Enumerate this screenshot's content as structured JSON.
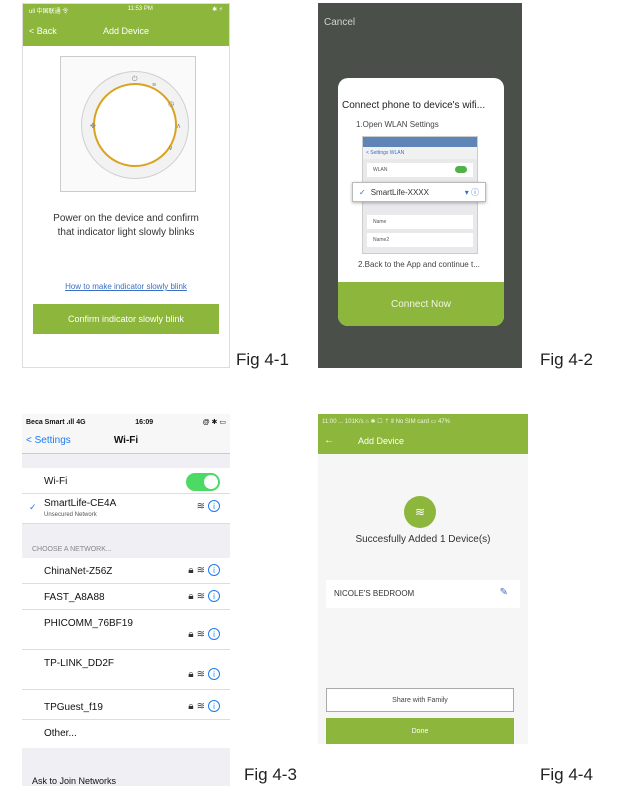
{
  "figures": {
    "fig1": "Fig 4-1",
    "fig2": "Fig 4-2",
    "fig3": "Fig 4-3",
    "fig4": "Fig 4-4"
  },
  "colors": {
    "accent_green": "#8db63c",
    "ios_blue": "#1a7cf5",
    "link_blue": "#3a6fc4",
    "dial_gold": "#d9a321"
  },
  "screen1": {
    "status_left": "ull 中国联通 令",
    "status_time": "11:53 PM",
    "status_right": "✱ ⚡",
    "back": "< Back",
    "title": "Add Device",
    "instruction_line1": "Power on the device and confirm",
    "instruction_line2": "that indicator light slowly blinks",
    "help_link": "How to make indicator slowly blink",
    "confirm_button": "Confirm indicator slowly blink",
    "dial_icons": [
      "power-icon",
      "menu-icon",
      "clock-icon",
      "up-icon",
      "down-icon",
      "fan-icon"
    ]
  },
  "screen2": {
    "cancel": "Cancel",
    "dialog_title": "Connect phone to device's wifi...",
    "step1": "1.Open WLAN Settings",
    "mini_nav": "< Settings   WLAN",
    "mini_wlan": "WLAN",
    "mini_other1": "Name",
    "mini_other2": "Name2",
    "selected_network": "SmartLife-XXXX",
    "step2": "2.Back to the App and continue t...",
    "connect_button": "Connect Now"
  },
  "screen3": {
    "status_left": "Beca Smart .ıll 4G",
    "status_time": "16:09",
    "status_right": "@ ✱ ▭",
    "back": "< Settings",
    "title": "Wi-Fi",
    "wifi_label": "Wi-Fi",
    "wifi_on": true,
    "connected": {
      "name": "SmartLife-CE4A",
      "sub": "Unsecured Network"
    },
    "section_header": "CHOOSE A NETWORK...",
    "networks": [
      "ChinaNet-Z56Z",
      "FAST_A8A88",
      "PHICOMM_76BF19",
      "TP-LINK_DD2F",
      "TPGuest_f19"
    ],
    "other": "Other...",
    "cutoff_text": "Ask to Join Networks"
  },
  "screen4": {
    "status": "11:00 ... 101K/s ⌂ ✱ ☐ ⇡ Ⅱ No SIM card ▭ 47%",
    "title": "Add Device",
    "success": "Succesfully Added 1 Device(s)",
    "device_name": "NICOLE'S BEDROOM",
    "share_button": "Share with Family",
    "done_button": "Done"
  }
}
